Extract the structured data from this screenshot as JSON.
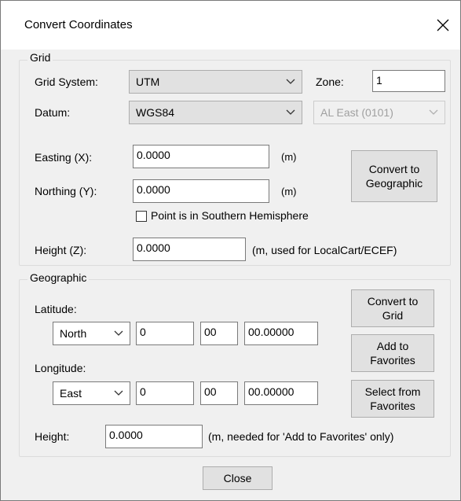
{
  "window": {
    "title": "Convert Coordinates"
  },
  "grid": {
    "group_label": "Grid",
    "grid_system_label": "Grid System:",
    "grid_system_value": "UTM",
    "zone_label": "Zone:",
    "zone_value": "1",
    "datum_label": "Datum:",
    "datum_value": "WGS84",
    "state_plane_value": "AL East  (0101)",
    "easting_label": "Easting (X):",
    "easting_value": "0.0000",
    "easting_unit": "(m)",
    "northing_label": "Northing (Y):",
    "northing_value": "0.0000",
    "northing_unit": "(m)",
    "southern_hemisphere_label": "Point is in Southern Hemisphere",
    "southern_hemisphere_checked": false,
    "height_label": "Height (Z):",
    "height_value": "0.0000",
    "height_unit": "(m, used for LocalCart/ECEF)",
    "convert_button": "Convert to\nGeographic"
  },
  "geographic": {
    "group_label": "Geographic",
    "latitude_label": "Latitude:",
    "lat_hemisphere": "North",
    "lat_degrees": "0",
    "lat_minutes": "00",
    "lat_seconds": "00.00000",
    "longitude_label": "Longitude:",
    "lon_hemisphere": "East",
    "lon_degrees": "0",
    "lon_minutes": "00",
    "lon_seconds": "00.00000",
    "height_label": "Height:",
    "height_value": "0.0000",
    "height_unit": "(m, needed for 'Add to Favorites' only)",
    "convert_button": "Convert to\nGrid",
    "add_favorites_button": "Add to\nFavorites",
    "select_favorites_button": "Select from\nFavorites"
  },
  "footer": {
    "close_button": "Close"
  },
  "icons": {
    "close": "close-icon",
    "dropdown": "chevron-down-icon"
  }
}
